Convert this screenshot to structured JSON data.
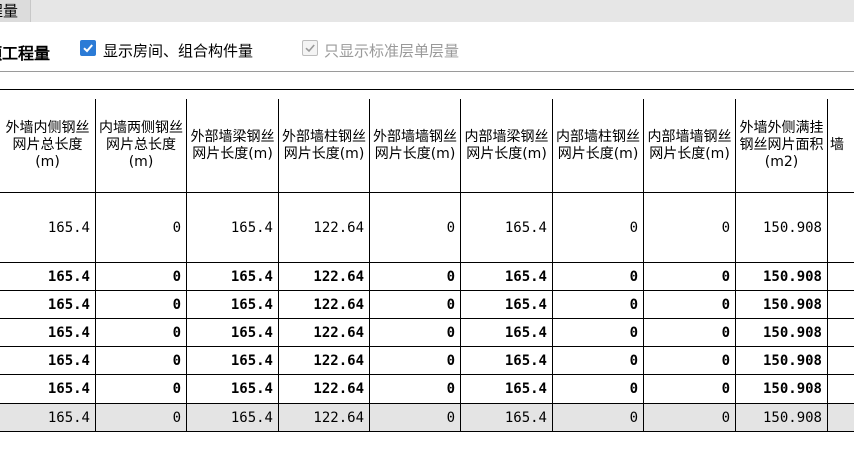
{
  "tab": {
    "label": "程量"
  },
  "toolbar": {
    "section_label": "额工程量",
    "show_rooms_checkbox": {
      "label": "显示房间、组合构件量",
      "checked": true
    },
    "standard_floor_checkbox": {
      "label": "只显示标准层单层量",
      "checked": true,
      "disabled": true
    }
  },
  "table": {
    "columns": [
      "外墙内侧钢丝网片总长度(m)",
      "内墙两侧钢丝网片总长度(m)",
      "外部墙梁钢丝网片长度(m)",
      "外部墙柱钢丝网片长度(m)",
      "外部墙墙钢丝网片长度(m)",
      "内部墙梁钢丝网片长度(m)",
      "内部墙柱钢丝网片长度(m)",
      "内部墙墙钢丝网片长度(m)",
      "外墙外侧满挂钢丝网片面积(m2)",
      "墙"
    ],
    "rows": [
      {
        "style": "normal",
        "cells": [
          "165.4",
          "0",
          "165.4",
          "122.64",
          "0",
          "165.4",
          "0",
          "0",
          "150.908",
          ""
        ]
      },
      {
        "style": "bold",
        "cells": [
          "165.4",
          "0",
          "165.4",
          "122.64",
          "0",
          "165.4",
          "0",
          "0",
          "150.908",
          ""
        ]
      },
      {
        "style": "bold",
        "cells": [
          "165.4",
          "0",
          "165.4",
          "122.64",
          "0",
          "165.4",
          "0",
          "0",
          "150.908",
          ""
        ]
      },
      {
        "style": "bold",
        "cells": [
          "165.4",
          "0",
          "165.4",
          "122.64",
          "0",
          "165.4",
          "0",
          "0",
          "150.908",
          ""
        ]
      },
      {
        "style": "bold",
        "cells": [
          "165.4",
          "0",
          "165.4",
          "122.64",
          "0",
          "165.4",
          "0",
          "0",
          "150.908",
          ""
        ]
      },
      {
        "style": "bold",
        "cells": [
          "165.4",
          "0",
          "165.4",
          "122.64",
          "0",
          "165.4",
          "0",
          "0",
          "150.908",
          ""
        ]
      },
      {
        "style": "total",
        "cells": [
          "165.4",
          "0",
          "165.4",
          "122.64",
          "0",
          "165.4",
          "0",
          "0",
          "150.908",
          ""
        ]
      }
    ]
  },
  "colors": {
    "accent": "#2b7bd6",
    "total_row": "#e4e4e4",
    "disabled_text": "#9a9a9a"
  }
}
